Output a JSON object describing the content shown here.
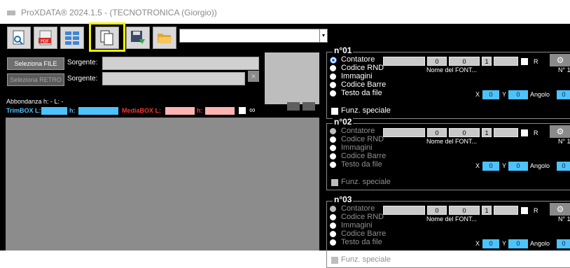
{
  "window": {
    "title": "ProXDATA® 2024.1.5 - (TECNOTRONICA (Giorgio))"
  },
  "toolbar": {
    "buttons": [
      {
        "icon": "preview-page-icon"
      },
      {
        "icon": "pdf-icon"
      },
      {
        "icon": "grid-layout-icon"
      },
      {
        "icon": "copy-document-icon"
      },
      {
        "icon": "save-export-icon"
      },
      {
        "icon": "open-folder-icon"
      }
    ],
    "combo_value": ""
  },
  "left": {
    "select_file_label": "Seleziona FILE",
    "source_label": "Sorgente:",
    "select_back_label": "Seleziona RETRO",
    "abbondanza": "Abbondanza h: -   L: -",
    "trimbox_l": "TrimBOX L:",
    "trimbox_h": "h:",
    "mediabox_l": "MediaBOX L:",
    "mediabox_h": "h:",
    "infinity": "∞",
    "clear_icon": "×"
  },
  "panels": [
    {
      "title": "n°01",
      "active": true,
      "options": [
        "Contatore",
        "Codice RND",
        "Immagini",
        "Codice Barre",
        "Testo da file"
      ],
      "selected": 0,
      "counter_values": [
        "0",
        "0",
        "1"
      ],
      "r_label": "R",
      "font_label": "Nome del FONT...",
      "n_label": "N° 1",
      "x_label": "X",
      "x_value": "0",
      "y_label": "Y",
      "y_value": "0",
      "angle_label": "Angolo",
      "angle_value": "0",
      "special_label": "Funz. speciale"
    },
    {
      "title": "n°02",
      "active": false,
      "options": [
        "Contatore",
        "Codice RND",
        "Immagini",
        "Codice Barre",
        "Testo da file"
      ],
      "selected": 0,
      "counter_values": [
        "0",
        "0",
        "1"
      ],
      "r_label": "R",
      "font_label": "Nome del FONT...",
      "n_label": "N° 1",
      "x_label": "X",
      "x_value": "0",
      "y_label": "Y",
      "y_value": "0",
      "angle_label": "Angolo",
      "angle_value": "0",
      "special_label": "Funz. speciale"
    },
    {
      "title": "n°03",
      "active": false,
      "options": [
        "Contatore",
        "Codice RND",
        "Immagini",
        "Codice Barre",
        "Testo da file"
      ],
      "selected": 0,
      "counter_values": [
        "0",
        "0",
        "1"
      ],
      "r_label": "R",
      "font_label": "Nome del FONT...",
      "n_label": "N° 1",
      "x_label": "X",
      "x_value": "0",
      "y_label": "Y",
      "y_value": "0",
      "angle_label": "Angolo",
      "angle_value": "0",
      "special_label": "Funz. speciale"
    }
  ],
  "colors": {
    "highlight": "#f2f200",
    "trimbox": "#4cc3ff",
    "mediabox": "#ffb3b3",
    "mediabox_text": "#ff3333",
    "radio_selected": "#1e6fd9"
  }
}
